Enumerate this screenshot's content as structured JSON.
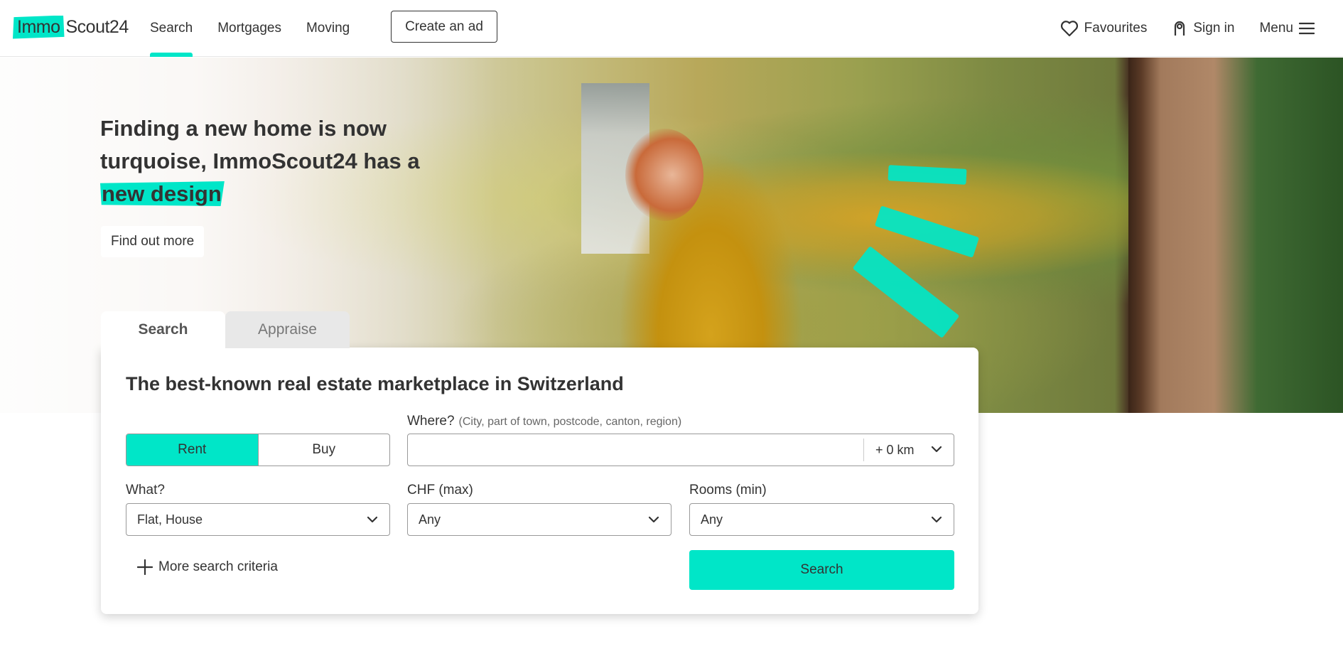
{
  "header": {
    "logo": {
      "part1": "Immo",
      "part2": "Scout24"
    },
    "nav": [
      {
        "label": "Search",
        "active": true
      },
      {
        "label": "Mortgages",
        "active": false
      },
      {
        "label": "Moving",
        "active": false
      }
    ],
    "create_ad_label": "Create an ad",
    "favourites_label": "Favourites",
    "sign_in_label": "Sign in",
    "menu_label": "Menu"
  },
  "hero": {
    "title_line1": "Finding a new home is now",
    "title_line2": "turquoise, ImmoScout24 has a",
    "title_highlight": "new design",
    "cta_label": "Find out more"
  },
  "search": {
    "tabs": [
      {
        "label": "Search",
        "active": true
      },
      {
        "label": "Appraise",
        "active": false
      }
    ],
    "title": "The best-known real estate marketplace in Switzerland",
    "mode": {
      "rent_label": "Rent",
      "buy_label": "Buy",
      "selected": "Rent"
    },
    "where": {
      "label": "Where?",
      "hint": "(City, part of town, postcode, canton, region)",
      "value": "",
      "radius": "+ 0 km"
    },
    "what": {
      "label": "What?",
      "value": "Flat, House"
    },
    "price": {
      "label": "CHF (max)",
      "value": "Any"
    },
    "rooms": {
      "label": "Rooms (min)",
      "value": "Any"
    },
    "more_criteria_label": "More search criteria",
    "submit_label": "Search"
  },
  "colors": {
    "accent": "#00e6c8",
    "text": "#333333",
    "border": "#999999"
  },
  "icons": {
    "favourites": "heart-icon",
    "sign_in": "user-icon",
    "menu": "hamburger-icon",
    "dropdown": "chevron-down-icon",
    "more": "plus-icon"
  }
}
